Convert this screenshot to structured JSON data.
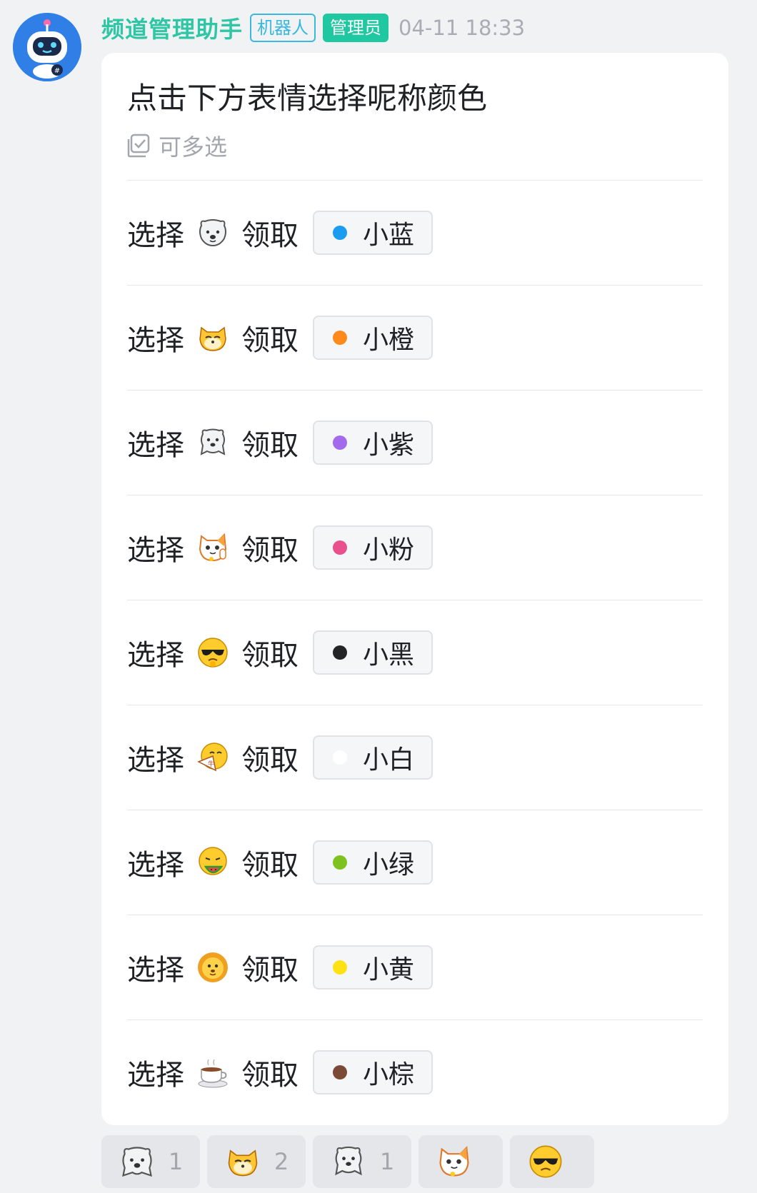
{
  "message": {
    "sender": "频道管理助手",
    "tag_bot": "机器人",
    "tag_admin": "管理员",
    "time": "04-11 18:33"
  },
  "card": {
    "title": "点击下方表情选择呢称颜色",
    "multi_select": "可多选",
    "rows": [
      {
        "select": "选择",
        "emoji": "bear-icon",
        "claim": "领取",
        "color_name": "小蓝",
        "dot_color": "#1a9cf0"
      },
      {
        "select": "选择",
        "emoji": "fox-icon",
        "claim": "领取",
        "color_name": "小橙",
        "dot_color": "#ff8a1c"
      },
      {
        "select": "选择",
        "emoji": "bear-waving-icon",
        "claim": "领取",
        "color_name": "小紫",
        "dot_color": "#a46aec"
      },
      {
        "select": "选择",
        "emoji": "lucky-cat-icon",
        "claim": "领取",
        "color_name": "小粉",
        "dot_color": "#e8508e"
      },
      {
        "select": "选择",
        "emoji": "sunglasses-face-icon",
        "claim": "领取",
        "color_name": "小黑",
        "dot_color": "#222426"
      },
      {
        "select": "选择",
        "emoji": "fan-face-icon",
        "claim": "领取",
        "color_name": "小白",
        "dot_color": "#ffffff"
      },
      {
        "select": "选择",
        "emoji": "watermelon-face-icon",
        "claim": "领取",
        "color_name": "小绿",
        "dot_color": "#7dc21e"
      },
      {
        "select": "选择",
        "emoji": "lion-icon",
        "claim": "领取",
        "color_name": "小黄",
        "dot_color": "#ffe214"
      },
      {
        "select": "选择",
        "emoji": "coffee-icon",
        "claim": "领取",
        "color_name": "小棕",
        "dot_color": "#7b4a36"
      }
    ]
  },
  "reactions": [
    {
      "emoji": "bear-icon",
      "count": "1"
    },
    {
      "emoji": "fox-icon",
      "count": "2"
    },
    {
      "emoji": "bear-waving-icon",
      "count": "1"
    },
    {
      "emoji": "lucky-cat-icon",
      "count": ""
    },
    {
      "emoji": "sunglasses-face-icon",
      "count": ""
    }
  ]
}
